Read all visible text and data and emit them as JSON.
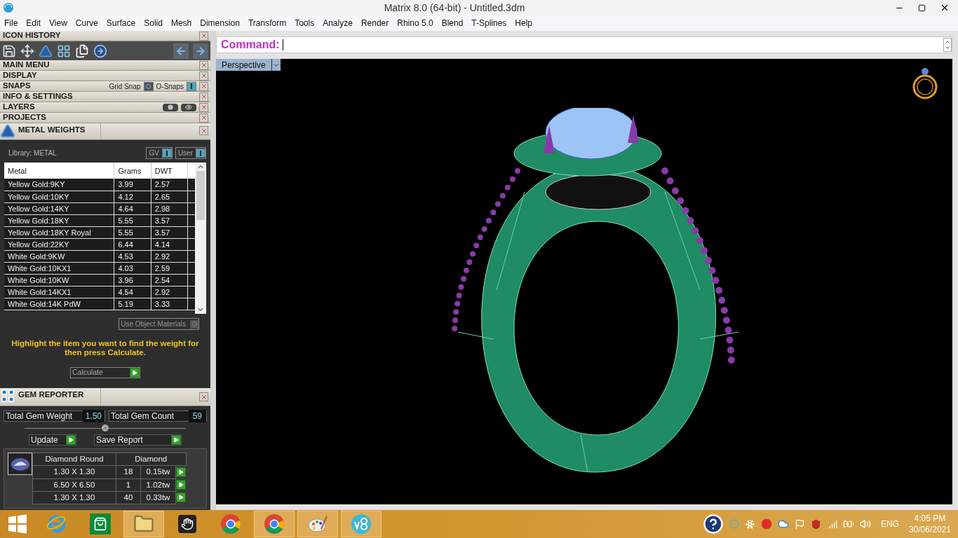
{
  "window": {
    "title": "Matrix 8.0 (64-bit) - Untitled.3dm"
  },
  "menu_bar": [
    "File",
    "Edit",
    "View",
    "Curve",
    "Surface",
    "Solid",
    "Mesh",
    "Dimension",
    "Transform",
    "Tools",
    "Analyze",
    "Render",
    "Rhino 5.0",
    "Blend",
    "T-Splines",
    "Help"
  ],
  "icon_history": {
    "title": "ICON HISTORY"
  },
  "panels": [
    {
      "title": "MAIN MENU",
      "kind": "plain"
    },
    {
      "title": "DISPLAY",
      "kind": "plain"
    },
    {
      "title": "SNAPS",
      "kind": "snaps",
      "toggles": [
        {
          "label": "Grid Snap",
          "on": false
        },
        {
          "label": "O-Snaps",
          "on": true
        }
      ]
    },
    {
      "title": "INFO & SETTINGS",
      "kind": "plain"
    },
    {
      "title": "LAYERS",
      "kind": "layers"
    },
    {
      "title": "PROJECTS",
      "kind": "plain"
    }
  ],
  "metal_weights": {
    "title": "METAL WEIGHTS",
    "library": "Library: METAL",
    "toggles": [
      {
        "label": "GV",
        "on": true
      },
      {
        "label": "User",
        "on": true
      }
    ],
    "columns": [
      "Metal",
      "Grams",
      "DWT"
    ],
    "rows": [
      {
        "metal": "Yellow Gold:9KY",
        "grams": "3.99",
        "dwt": "2.57"
      },
      {
        "metal": "Yellow Gold:10KY",
        "grams": "4.12",
        "dwt": "2.65"
      },
      {
        "metal": "Yellow Gold:14KY",
        "grams": "4.64",
        "dwt": "2.98"
      },
      {
        "metal": "Yellow Gold:18KY",
        "grams": "5.55",
        "dwt": "3.57"
      },
      {
        "metal": "Yellow Gold:18KY Royal",
        "grams": "5.55",
        "dwt": "3.57"
      },
      {
        "metal": "Yellow Gold:22KY",
        "grams": "6.44",
        "dwt": "4.14"
      },
      {
        "metal": "White Gold:9KW",
        "grams": "4.53",
        "dwt": "2.92"
      },
      {
        "metal": "White Gold:10KX1",
        "grams": "4.03",
        "dwt": "2.59"
      },
      {
        "metal": "White Gold:10KW",
        "grams": "3.96",
        "dwt": "2.54"
      },
      {
        "metal": "White Gold:14KX1",
        "grams": "4.54",
        "dwt": "2.92"
      },
      {
        "metal": "White Gold:14K PdW",
        "grams": "5.19",
        "dwt": "3.33"
      }
    ],
    "use_object_materials": {
      "label": "Use Object Materials",
      "on": false
    },
    "hint": "Highlight the item you want to find the weight for then press Calculate.",
    "calculate": "Calculate"
  },
  "gem_reporter": {
    "title": "GEM REPORTER",
    "weight_label": "Total Gem Weight",
    "weight": "1.50",
    "count_label": "Total Gem Count",
    "count": "59",
    "buttons": [
      "Update",
      "Save Report"
    ],
    "columns": [
      "Diamond Round",
      "Diamond"
    ],
    "rows": [
      {
        "size": "1.30 X 1.30",
        "count": "18",
        "weight": "0.15tw"
      },
      {
        "size": "6.50 X 6.50",
        "count": "1",
        "weight": "1.02tw"
      },
      {
        "size": "1.30 X 1.30",
        "count": "40",
        "weight": "0.33tw"
      }
    ]
  },
  "command": {
    "label": "Command:"
  },
  "viewport": {
    "label": "Perspective"
  },
  "taskbar": {
    "apps": [
      {
        "kind": "ie",
        "running": false
      },
      {
        "kind": "store",
        "running": false
      },
      {
        "kind": "folder",
        "running": true
      },
      {
        "kind": "touch",
        "running": false
      },
      {
        "kind": "chrome",
        "running": false
      },
      {
        "kind": "chrome",
        "running": true
      },
      {
        "kind": "paint",
        "running": true
      },
      {
        "kind": "v8",
        "running": true
      }
    ],
    "language": "ENG",
    "time": "4:05 PM",
    "date": "30/06/2021"
  }
}
